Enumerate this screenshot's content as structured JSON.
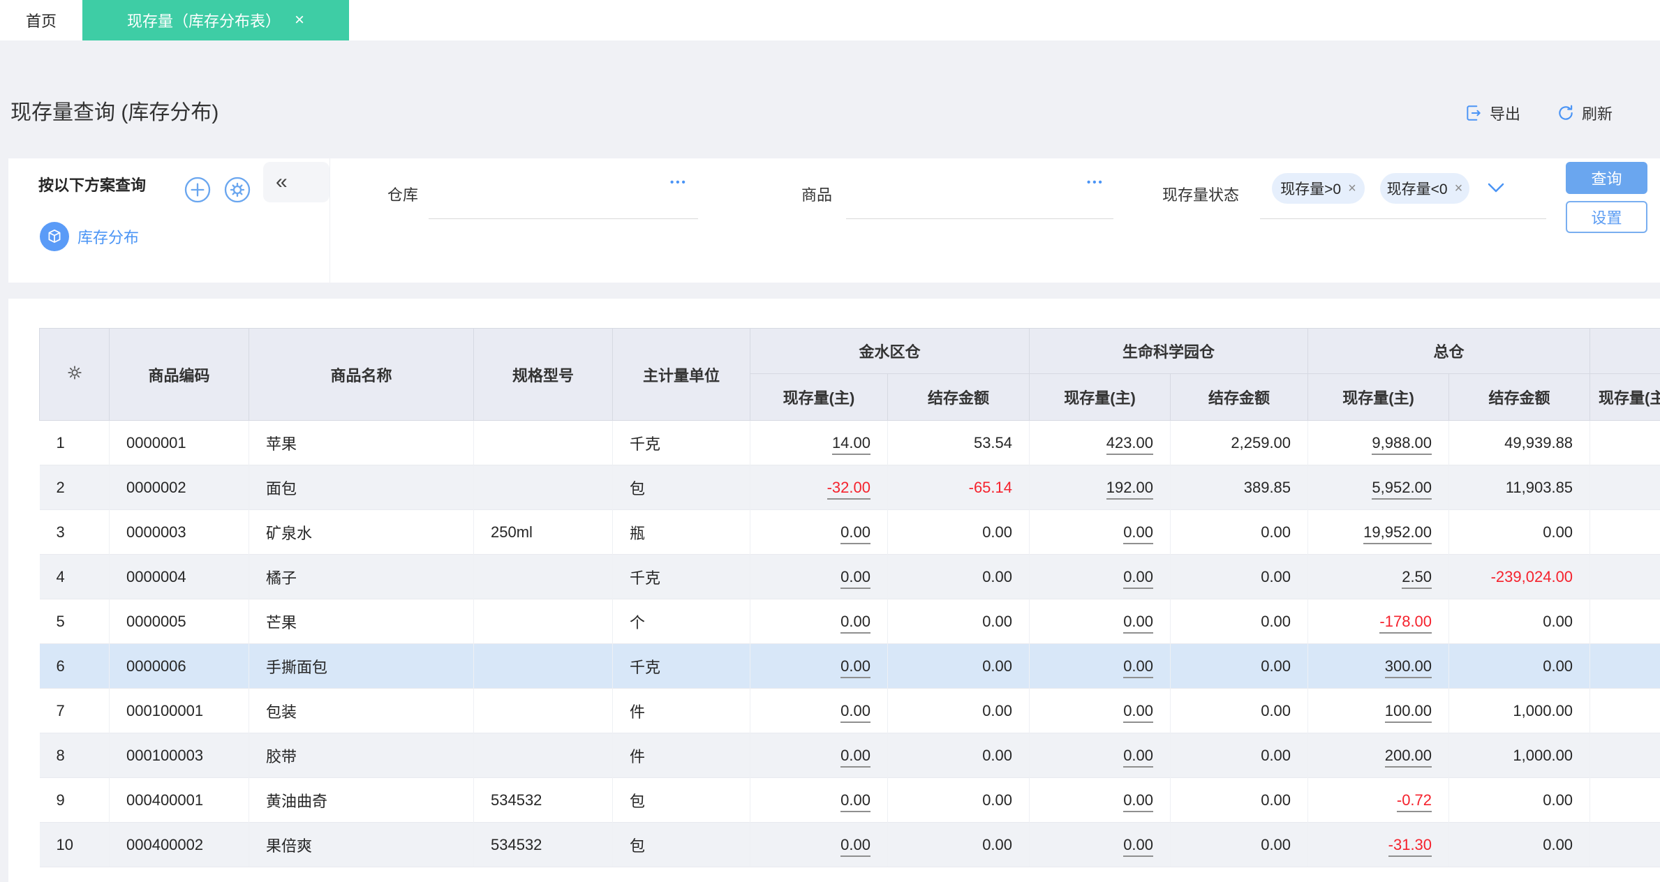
{
  "tabs": {
    "home": "首页",
    "active": "现存量（库存分布表）",
    "close": "×"
  },
  "page": {
    "title": "现存量查询 (库存分布)",
    "export_label": "导出",
    "refresh_label": "刷新"
  },
  "filter": {
    "scheme_title": "按以下方案查询",
    "collapse_icon": "«",
    "scheme_item": "库存分布",
    "warehouse_label": "仓库",
    "product_label": "商品",
    "status_label": "现存量状态",
    "ellipsis_icon": "•••",
    "tags": [
      {
        "label": "现存量>0",
        "close": "×"
      },
      {
        "label": "现存量<0",
        "close": "×"
      }
    ],
    "query_button": "查询",
    "settings_button": "设置"
  },
  "table": {
    "headers": {
      "code": "商品编码",
      "name": "商品名称",
      "spec": "规格型号",
      "unit": "主计量单位",
      "qty": "现存量(主)",
      "amount": "结存金额"
    },
    "groups": [
      "金水区仓",
      "生命科学园仓",
      "总仓"
    ],
    "overflow_header": "现存量(主)",
    "rows": [
      {
        "no": "1",
        "code": "0000001",
        "name": "苹果",
        "spec": "",
        "unit": "千克",
        "values": [
          {
            "t": "14.00",
            "link": true
          },
          {
            "t": "53.54"
          },
          {
            "t": "423.00",
            "link": true
          },
          {
            "t": "2,259.00"
          },
          {
            "t": "9,988.00",
            "link": true
          },
          {
            "t": "49,939.88"
          }
        ]
      },
      {
        "no": "2",
        "code": "0000002",
        "name": "面包",
        "spec": "",
        "unit": "包",
        "values": [
          {
            "t": "-32.00",
            "link": true,
            "neg": true
          },
          {
            "t": "-65.14",
            "neg": true
          },
          {
            "t": "192.00",
            "link": true
          },
          {
            "t": "389.85"
          },
          {
            "t": "5,952.00",
            "link": true
          },
          {
            "t": "11,903.85"
          }
        ]
      },
      {
        "no": "3",
        "code": "0000003",
        "name": "矿泉水",
        "spec": "250ml",
        "unit": "瓶",
        "values": [
          {
            "t": "0.00",
            "link": true
          },
          {
            "t": "0.00"
          },
          {
            "t": "0.00",
            "link": true
          },
          {
            "t": "0.00"
          },
          {
            "t": "19,952.00",
            "link": true
          },
          {
            "t": "0.00"
          }
        ]
      },
      {
        "no": "4",
        "code": "0000004",
        "name": "橘子",
        "spec": "",
        "unit": "千克",
        "values": [
          {
            "t": "0.00",
            "link": true
          },
          {
            "t": "0.00"
          },
          {
            "t": "0.00",
            "link": true
          },
          {
            "t": "0.00"
          },
          {
            "t": "2.50",
            "link": true
          },
          {
            "t": "-239,024.00",
            "neg": true
          }
        ]
      },
      {
        "no": "5",
        "code": "0000005",
        "name": "芒果",
        "spec": "",
        "unit": "个",
        "values": [
          {
            "t": "0.00",
            "link": true
          },
          {
            "t": "0.00"
          },
          {
            "t": "0.00",
            "link": true
          },
          {
            "t": "0.00"
          },
          {
            "t": "-178.00",
            "link": true,
            "neg": true
          },
          {
            "t": "0.00"
          }
        ]
      },
      {
        "no": "6",
        "code": "0000006",
        "name": "手撕面包",
        "spec": "",
        "unit": "千克",
        "selected": true,
        "values": [
          {
            "t": "0.00",
            "link": true
          },
          {
            "t": "0.00"
          },
          {
            "t": "0.00",
            "link": true
          },
          {
            "t": "0.00"
          },
          {
            "t": "300.00",
            "link": true
          },
          {
            "t": "0.00"
          }
        ]
      },
      {
        "no": "7",
        "code": "000100001",
        "name": "包装",
        "spec": "",
        "unit": "件",
        "values": [
          {
            "t": "0.00",
            "link": true
          },
          {
            "t": "0.00"
          },
          {
            "t": "0.00",
            "link": true
          },
          {
            "t": "0.00"
          },
          {
            "t": "100.00",
            "link": true
          },
          {
            "t": "1,000.00"
          }
        ]
      },
      {
        "no": "8",
        "code": "000100003",
        "name": "胶带",
        "spec": "",
        "unit": "件",
        "values": [
          {
            "t": "0.00",
            "link": true
          },
          {
            "t": "0.00"
          },
          {
            "t": "0.00",
            "link": true
          },
          {
            "t": "0.00"
          },
          {
            "t": "200.00",
            "link": true
          },
          {
            "t": "1,000.00"
          }
        ]
      },
      {
        "no": "9",
        "code": "000400001",
        "name": "黄油曲奇",
        "spec": "534532",
        "unit": "包",
        "values": [
          {
            "t": "0.00",
            "link": true
          },
          {
            "t": "0.00"
          },
          {
            "t": "0.00",
            "link": true
          },
          {
            "t": "0.00"
          },
          {
            "t": "-0.72",
            "link": true,
            "neg": true
          },
          {
            "t": "0.00"
          }
        ]
      },
      {
        "no": "10",
        "code": "000400002",
        "name": "果倍爽",
        "spec": "534532",
        "unit": "包",
        "values": [
          {
            "t": "0.00",
            "link": true
          },
          {
            "t": "0.00"
          },
          {
            "t": "0.00",
            "link": true
          },
          {
            "t": "0.00"
          },
          {
            "t": "-31.30",
            "link": true,
            "neg": true
          },
          {
            "t": "0.00"
          }
        ]
      }
    ]
  },
  "colors": {
    "tab_active": "#3ecda5",
    "accent_blue": "#4a94f5",
    "button_blue": "#6aa6ef",
    "negative_red": "#f5222d",
    "tag_bg": "#e6effc",
    "selected_row": "#d8e7f8",
    "header_bg": "#e9ebf3",
    "zebra_row": "#f0f2f6"
  }
}
